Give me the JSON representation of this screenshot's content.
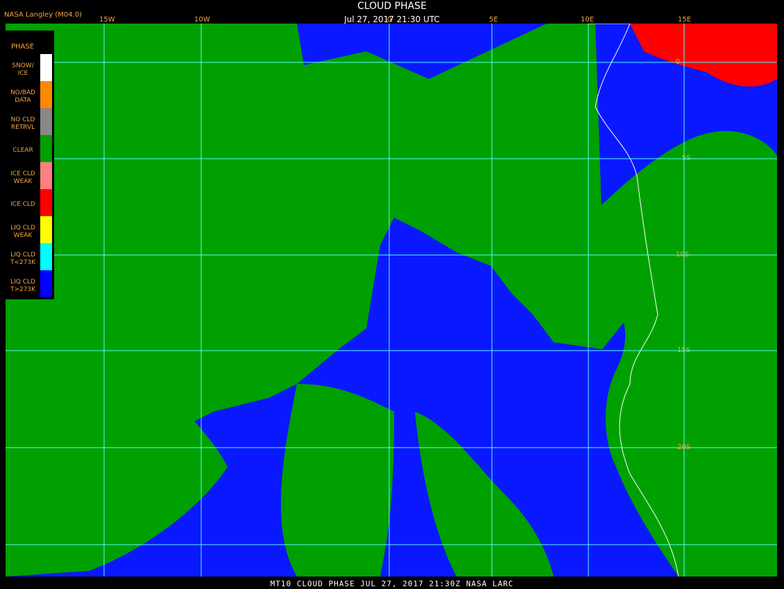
{
  "header": {
    "title": "CLOUD PHASE",
    "subtitle": "Jul 27, 2017 21:30 UTC",
    "source": "NASA Langley (M04.0)"
  },
  "legend": {
    "title": "PHASE",
    "items": [
      {
        "label1": "SNOW/",
        "label2": "ICE",
        "color": "#ffffff"
      },
      {
        "label1": "NO/BAD",
        "label2": "DATA",
        "color": "#ff8800"
      },
      {
        "label1": "NO CLD",
        "label2": "RETRVL",
        "color": "#888888"
      },
      {
        "label1": "CLEAR",
        "label2": "",
        "color": "#00a000"
      },
      {
        "label1": "ICE CLD",
        "label2": "WEAK",
        "color": "#ff8080"
      },
      {
        "label1": "ICE CLD",
        "label2": "",
        "color": "#ff0000"
      },
      {
        "label1": "LIQ CLD",
        "label2": "WEAK",
        "color": "#ffff00"
      },
      {
        "label1": "LIQ CLD",
        "label2": "T<273K",
        "color": "#00ffff"
      },
      {
        "label1": "LIQ CLD",
        "label2": "T>273K",
        "color": "#0000ff"
      }
    ]
  },
  "grid": {
    "lon_labels": [
      "15W",
      "10W",
      "0",
      "5E",
      "10E",
      "15E"
    ],
    "lat_labels": [
      "0",
      "5S",
      "10S",
      "15S",
      "20S"
    ]
  },
  "footer": "MT10  CLOUD PHASE  JUL 27, 2017 21:30Z  NASA LARC"
}
